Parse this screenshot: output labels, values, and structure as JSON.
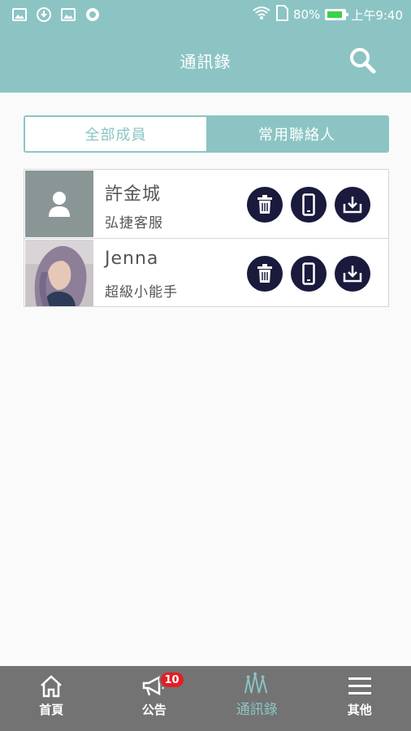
{
  "status_bar": {
    "left_icons": [
      "image-icon",
      "download-icon",
      "image-icon",
      "circle-icon"
    ],
    "battery": "80%",
    "time": "上午9:40"
  },
  "header": {
    "title": "通訊錄"
  },
  "segmented_control": {
    "tabs": [
      {
        "label": "全部成員",
        "active": false
      },
      {
        "label": "常用聯絡人",
        "active": true
      }
    ]
  },
  "contacts": [
    {
      "name": "許金城",
      "subtitle": "弘捷客服",
      "avatar": "person-placeholder-icon"
    },
    {
      "name": "Jenna",
      "subtitle": "超級小能手",
      "avatar": "photo"
    }
  ],
  "contact_actions": [
    "delete-icon",
    "phone-icon",
    "download-icon"
  ],
  "bottom_nav": {
    "items": [
      {
        "label": "首頁",
        "icon": "home-icon"
      },
      {
        "label": "公告",
        "icon": "megaphone-icon",
        "badge": "10"
      },
      {
        "label": "通訊錄",
        "icon": "contacts-icon",
        "active": true
      },
      {
        "label": "其他",
        "icon": "menu-icon"
      }
    ]
  },
  "colors": {
    "primary": "#8cc4c4",
    "action": "#1a1a3d",
    "tabbar": "#737373",
    "badge": "#e31e24"
  }
}
